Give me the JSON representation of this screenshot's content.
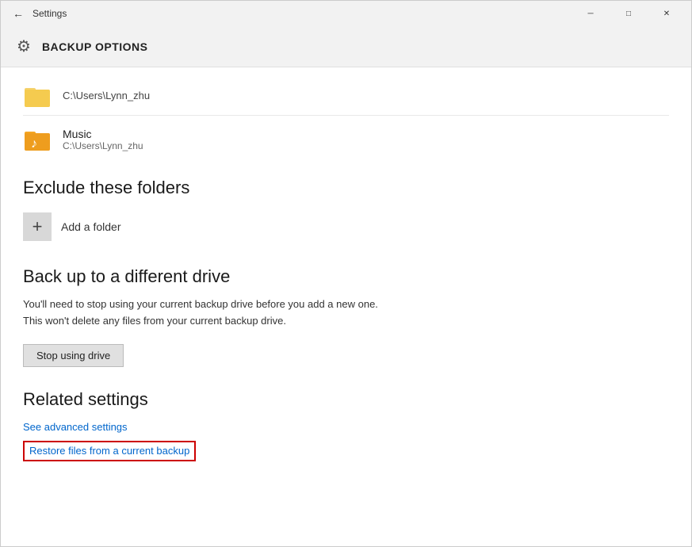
{
  "titlebar": {
    "back_label": "←",
    "title": "Settings",
    "minimize_label": "─",
    "maximize_label": "□",
    "close_label": "✕"
  },
  "header": {
    "gear_icon": "⚙",
    "title": "BACKUP OPTIONS"
  },
  "content": {
    "partial_folder": {
      "path": "C:\\Users\\Lynn_zhu"
    },
    "music_folder": {
      "name": "Music",
      "path": "C:\\Users\\Lynn_zhu"
    },
    "exclude_section": {
      "heading": "Exclude these folders",
      "add_label": "Add a folder",
      "plus_icon": "+"
    },
    "backup_drive_section": {
      "heading": "Back up to a different drive",
      "description": "You'll need to stop using your current backup drive before you add a new one. This won't delete any files from your current backup drive.",
      "stop_btn_label": "Stop using drive"
    },
    "related_settings": {
      "heading": "Related settings",
      "advanced_link": "See advanced settings",
      "restore_link": "Restore files from a current backup"
    }
  }
}
